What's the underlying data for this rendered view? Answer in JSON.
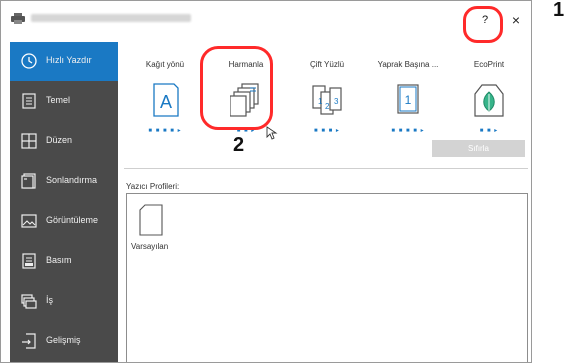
{
  "window": {
    "help_label": "?",
    "close_label": "×"
  },
  "sidebar": {
    "items": [
      {
        "label": "Hızlı Yazdır",
        "icon": "clock-icon",
        "active": true
      },
      {
        "label": "Temel",
        "icon": "document-lines-icon"
      },
      {
        "label": "Düzen",
        "icon": "grid-icon"
      },
      {
        "label": "Sonlandırma",
        "icon": "stapled-pages-icon"
      },
      {
        "label": "Görüntüleme",
        "icon": "image-icon"
      },
      {
        "label": "Basım",
        "icon": "printer-tray-icon"
      },
      {
        "label": "İş",
        "icon": "stacked-folders-icon"
      },
      {
        "label": "Gelişmiş",
        "icon": "arrow-into-page-icon"
      }
    ]
  },
  "quick_print": {
    "tiles": [
      {
        "label": "Kağıt yönü",
        "icon": "portrait-page-a-icon"
      },
      {
        "label": "Harmanla",
        "icon": "collated-pages-icon"
      },
      {
        "label": "Çift Yüzlü",
        "icon": "duplex-pages-icon"
      },
      {
        "label": "Yaprak Başına ...",
        "icon": "pages-per-sheet-icon"
      },
      {
        "label": "EcoPrint",
        "icon": "leaf-icon"
      }
    ],
    "reset_label": "Sıfırla"
  },
  "profiles": {
    "label": "Yazıcı Profileri:",
    "items": [
      {
        "label": "Varsayılan"
      }
    ]
  },
  "callouts": [
    {
      "number": "1"
    },
    {
      "number": "2"
    }
  ],
  "colors": {
    "accent": "#1a79c4",
    "sidebar": "#4a4a4a",
    "callout": "#ff2a2a"
  }
}
